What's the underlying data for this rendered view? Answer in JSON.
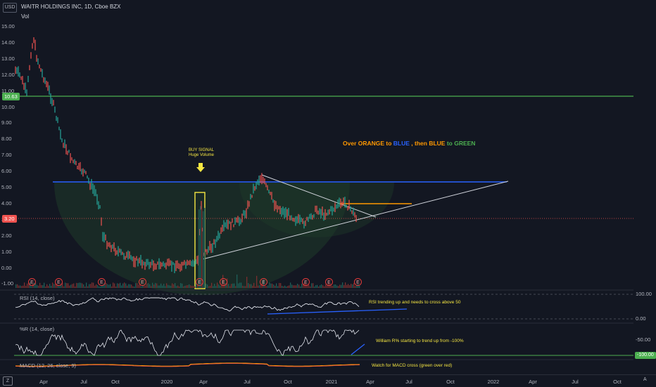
{
  "header": {
    "currency_label": "USD",
    "symbol_title": "WAITR HOLDINGS INC, 1D, Cboe BZX",
    "volume_label": "Vol"
  },
  "price_axis": {
    "labels": [
      "15.00",
      "14.00",
      "13.00",
      "12.00",
      "11.00",
      "10.00",
      "9.00",
      "8.00",
      "7.00",
      "6.00",
      "5.00",
      "4.00",
      "3.00",
      "2.00",
      "1.00",
      "0.00",
      "-1.00"
    ],
    "current_price": "3.20",
    "level_price": "10.63"
  },
  "time_axis": {
    "labels": [
      "Apr",
      "Jul",
      "Oct",
      "2020",
      "Apr",
      "Jul",
      "Oct",
      "2021",
      "Apr",
      "Jul",
      "Oct",
      "2022",
      "Apr",
      "Jul",
      "Oct"
    ]
  },
  "annotations": {
    "headline_part1": "Over ORANGE to ",
    "headline_blue": "BLUE",
    "headline_part2": " , then BLUE ",
    "headline_green": "to GREEN",
    "buy_signal": "BUY SIGNAL",
    "buy_signal_sub": "Huge Volume",
    "earnings_marker": "E",
    "rsi_note": "RSI trending up and needs to cross above 50",
    "williams_note": "William R% starting to trend up from -100%",
    "macd_note": "Watch for MACD cross (green over red)"
  },
  "indicators": {
    "rsi": {
      "title": "RSI (14, close)",
      "axis_top": "100.00",
      "axis_bottom": "0.00"
    },
    "williams": {
      "title": "%R (14, close)",
      "axis_top": "-50.00",
      "axis_bottom": "-100.00"
    },
    "macd": {
      "title": "MACD (12, 26, close, 9)"
    }
  },
  "toolbar": {
    "logo_icon": "tradingview-logo-icon",
    "auto_label": "A"
  },
  "colors": {
    "background": "#131722",
    "up": "#26a69a",
    "down": "#ef5350",
    "blue_line": "#2962ff",
    "green_line": "#4caf50",
    "orange_line": "#ff9800",
    "yellow": "#f5e642"
  }
}
